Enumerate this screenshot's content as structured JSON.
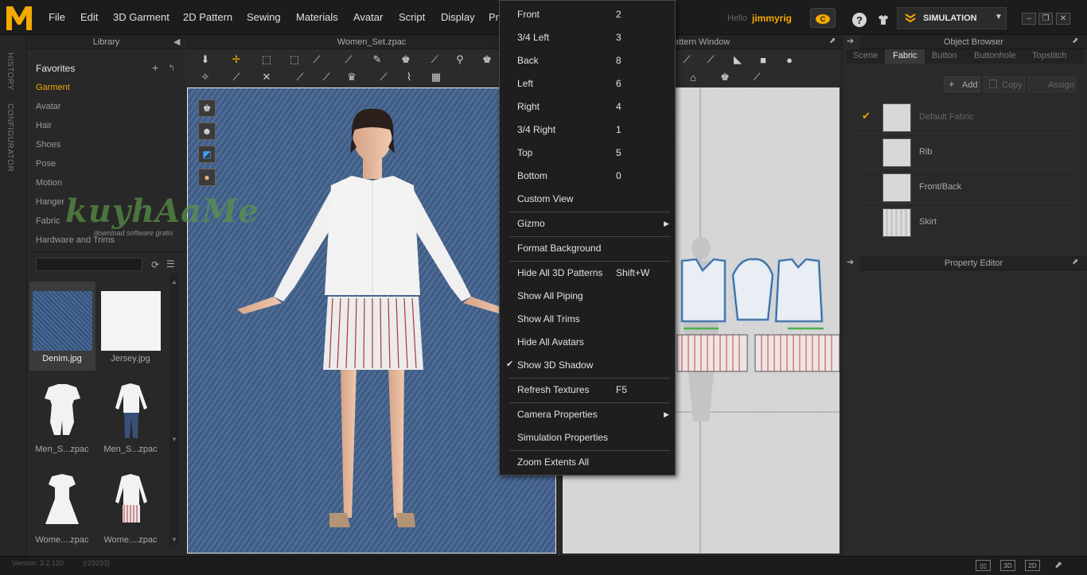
{
  "menu": [
    "File",
    "Edit",
    "3D Garment",
    "2D Pattern",
    "Sewing",
    "Materials",
    "Avatar",
    "Script",
    "Display",
    "Pr"
  ],
  "user": {
    "hello": "Hello",
    "name": "jimmyrig"
  },
  "simulation_label": "SIMULATION",
  "left_tabs": [
    "HISTORY",
    "CONFIGURATOR"
  ],
  "library": {
    "title": "Library",
    "favorites": "Favorites",
    "items": [
      "Garment",
      "Avatar",
      "Hair",
      "Shoes",
      "Pose",
      "Motion",
      "Hanger",
      "Fabric",
      "Hardware and Trims"
    ],
    "selected": "Garment",
    "thumbs": [
      {
        "label": "Denim.jpg"
      },
      {
        "label": "Jersey.jpg"
      },
      {
        "label": "Men_S...zpac"
      },
      {
        "label": "Men_S...zpac"
      },
      {
        "label": "Wome....zpac"
      },
      {
        "label": "Wome....zpac"
      }
    ]
  },
  "window3d": {
    "title": "Women_Set.zpac"
  },
  "window2d": {
    "title": "attern Window"
  },
  "context_menu": {
    "items": [
      {
        "label": "Front",
        "key": "2"
      },
      {
        "label": "3/4 Left",
        "key": "3"
      },
      {
        "label": "Back",
        "key": "8"
      },
      {
        "label": "Left",
        "key": "6"
      },
      {
        "label": "Right",
        "key": "4"
      },
      {
        "label": "3/4 Right",
        "key": "1"
      },
      {
        "label": "Top",
        "key": "5"
      },
      {
        "label": "Bottom",
        "key": "0"
      },
      {
        "label": "Custom View",
        "key": ""
      },
      {
        "label": "Gizmo",
        "key": ""
      },
      {
        "label": "Format Background",
        "key": ""
      },
      {
        "label": "Hide All 3D Patterns",
        "key": "Shift+W"
      },
      {
        "label": "Show All Piping",
        "key": ""
      },
      {
        "label": "Show All Trims",
        "key": ""
      },
      {
        "label": "Hide All Avatars",
        "key": ""
      },
      {
        "label": "Show 3D Shadow",
        "key": ""
      },
      {
        "label": "Refresh Textures",
        "key": "F5"
      },
      {
        "label": "Camera Properties",
        "key": ""
      },
      {
        "label": "Simulation Properties",
        "key": ""
      },
      {
        "label": "Zoom Extents All",
        "key": ""
      }
    ]
  },
  "object_browser": {
    "title": "Object Browser",
    "tabs": [
      "Scene",
      "Fabric",
      "Button",
      "Buttonhole",
      "Topstitch"
    ],
    "active_tab": "Fabric",
    "actions": [
      "Add",
      "Copy",
      "Assign"
    ],
    "fabrics": [
      "Default Fabric",
      "Rib",
      "Front/Back",
      "Skirt"
    ]
  },
  "property_editor": {
    "title": "Property Editor"
  },
  "watermark": {
    "text": "kuyhAaMe",
    "sub": "download software gratis"
  },
  "status": {
    "version": "Version: 3.2.120",
    "build": "(r29293)"
  },
  "colors": {
    "accent": "#f2a900",
    "denim": "#3e5a80"
  }
}
